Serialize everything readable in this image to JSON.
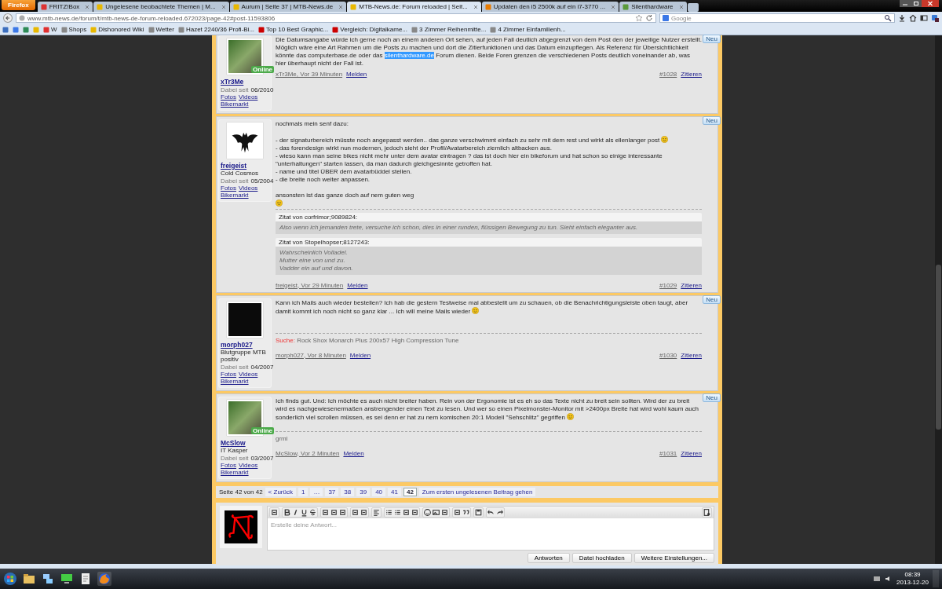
{
  "browser": {
    "menu_button": "Firefox",
    "tabs": [
      {
        "title": "FRITZ!Box",
        "selected": false
      },
      {
        "title": "Ungelesene beobachtete Themen | M...",
        "selected": false
      },
      {
        "title": "Aurum | Seite 37 | MTB-News.de",
        "selected": false
      },
      {
        "title": "MTB-News.de: Forum reloaded | Seit...",
        "selected": true
      },
      {
        "title": "Updaten den i5 2500k auf ein i7-3770 ...",
        "selected": false
      },
      {
        "title": "Silenthardware",
        "selected": false
      }
    ],
    "url": "www.mtb-news.de/forum/t/mtb-news-de-forum-reloaded.672023/page-42#post-11593806",
    "search_placeholder": "Google",
    "bookmarks": [
      {
        "label": "W"
      },
      {
        "label": "Shops"
      },
      {
        "label": "Dishonored Wiki"
      },
      {
        "label": "Wetter"
      },
      {
        "label": "Hazet 2240/36 Profi-Bi..."
      },
      {
        "label": "Top 10 Best Graphic..."
      },
      {
        "label": "Vergleich: Digitalkame..."
      },
      {
        "label": "3 Zimmer Reihenmitte..."
      },
      {
        "label": "4 Zimmer Einfamilienh..."
      }
    ]
  },
  "posts": [
    {
      "user": "xTr3Me",
      "avatar": {
        "kind": "photo"
      },
      "online": true,
      "online_label": "Online",
      "joined_label": "Dabei seit",
      "joined": "06/2010",
      "links": [
        "Fotos",
        "Videos",
        "Bikemarkt"
      ],
      "badge": "Neu",
      "body": [
        {
          "lines": [
            {
              "parts": [
                {
                  "kind": "text",
                  "text": "Die Datumsangabe würde ich gerne noch an einem anderen Ort sehen, auf jeden Fall deutlich abgegrenzt von dem Post den der jeweilige Nutzer erstellt."
                }
              ]
            },
            {
              "parts": [
                {
                  "kind": "text",
                  "text": "Möglich wäre eine Art Rahmen um die Posts zu machen und dort die Zitierfunktionen und das Datum einzupflegen. Als Referenz für Übersichtlichkeit könnte das computerbase.de oder das "
                },
                {
                  "kind": "highlight",
                  "text": "silenthardware.de"
                },
                {
                  "kind": "text",
                  "text": " Forum dienen. Beide Foren grenzen die verschiedenen Posts deutlich voneinander ab, was hier überhaupt nicht der Fall ist."
                }
              ]
            }
          ]
        }
      ],
      "author_time": "xTr3Me, Vor 39 Minuten",
      "report": "Melden",
      "number": "#1028",
      "quote_link": "Zitieren"
    },
    {
      "user": "freigeist",
      "title": "Cold Cosmos",
      "avatar": {
        "kind": "drawing"
      },
      "online": false,
      "joined_label": "Dabei seit",
      "joined": "05/2004",
      "links": [
        "Fotos",
        "Videos",
        "Bikemarkt"
      ],
      "badge": "Neu",
      "body": [
        {
          "lines": [
            {
              "parts": [
                {
                  "kind": "text",
                  "text": "nochmals mein senf dazu:"
                }
              ]
            }
          ]
        },
        {
          "lines": [
            {
              "parts": [
                {
                  "kind": "text",
                  "text": "- der signaturbereich müsste noch angepasst werden.. das ganze verschwimmt einfach zu sehr mit dem rest und wirkt als ellenlanger post"
                },
                {
                  "kind": "smiley"
                }
              ]
            },
            {
              "parts": [
                {
                  "kind": "text",
                  "text": "- das forendesign wirkt nun modernen, jedoch sieht der Profil/Avatarbereich ziemlich altbacken aus."
                }
              ]
            },
            {
              "parts": [
                {
                  "kind": "text",
                  "text": "- wieso kann man seine bikes nicht mehr unter dem avatar eintragen ? das ist doch hier ein bikeforum und hat schon so einige interessante \"unterhaltungen\" starten lassen, da man dadurch gleichgesinnte getroffen hat."
                }
              ]
            },
            {
              "parts": [
                {
                  "kind": "text",
                  "text": "- name und titel ÜBER dem avatarbüddel stellen."
                }
              ]
            },
            {
              "parts": [
                {
                  "kind": "text",
                  "text": "- die breite noch weiter anpassen."
                }
              ]
            }
          ]
        },
        {
          "lines": [
            {
              "parts": [
                {
                  "kind": "text",
                  "text": "ansonsten ist das ganze doch auf nem guten weg"
                }
              ]
            },
            {
              "parts": [
                {
                  "kind": "smiley"
                }
              ]
            }
          ]
        }
      ],
      "quotes": [
        {
          "header": "Zitat von corfrimor;9089824:",
          "lines": [
            "Also wenn ich jemanden trete, versuche ich schon, dies in einer runden, flüssigen Bewegung zu tun. Sieht einfach eleganter aus."
          ]
        },
        {
          "header": "Zitat von Stopelhopser;8127243:",
          "lines": [
            "Wahrscheinlich Volladel.",
            "Mutter eine von und zu.",
            "Vadder ein auf und davon."
          ]
        }
      ],
      "author_time": "freigeist, Vor 29 Minuten",
      "report": "Melden",
      "number": "#1029",
      "quote_link": "Zitieren"
    },
    {
      "user": "morph027",
      "title": "Blutgruppe MTB positiv",
      "avatar": {
        "kind": "dark"
      },
      "online": false,
      "joined_label": "Dabei seit",
      "joined": "04/2007",
      "links": [
        "Fotos",
        "Videos",
        "Bikemarkt"
      ],
      "badge": "Neu",
      "body": [
        {
          "lines": [
            {
              "parts": [
                {
                  "kind": "text",
                  "text": "Kann ich Mails auch wieder bestellen? Ich hab die gestern Testweise mal abbestellt um zu schauen, ob die Benachrichtigungsleiste oben taugt, aber damit kommt ich noch nicht so ganz klar ... Ich will meine Mails wieder"
                },
                {
                  "kind": "smiley"
                }
              ]
            }
          ]
        }
      ],
      "signature": {
        "label": "Suche:",
        "text": "Rock Shox Monarch Plus 200x57 High Compression Tune"
      },
      "author_time": "morph027, Vor 8 Minuten",
      "report": "Melden",
      "number": "#1030",
      "quote_link": "Zitieren"
    },
    {
      "user": "McSlow",
      "title": "IT Kasper",
      "avatar": {
        "kind": "photo"
      },
      "online": true,
      "online_label": "Online",
      "joined_label": "Dabei seit",
      "joined": "03/2007",
      "links": [
        "Fotos",
        "Videos",
        "Bikemarkt"
      ],
      "badge": "Neu",
      "body": [
        {
          "lines": [
            {
              "parts": [
                {
                  "kind": "text",
                  "text": "Ich finds gut. Und: Ich möchte es auch nicht breiter haben. Rein von der Ergonomie ist es eh so das Texte nicht zu breit sein sollten. Wird der zu breit wird es nachgewiesenermaßen anstrengender einen Text zu lesen. Und wer so einen Pixelmonster-Monitor mit >2400px Breite hat wird wohl kaum auch sonderlich viel scrollen müssen, es sei denn er hat zu nem komischen 20:1 Modell \"Sehschlitz\" gegriffen"
                },
                {
                  "kind": "smiley"
                }
              ]
            }
          ]
        }
      ],
      "signature": {
        "text": "grml"
      },
      "author_time": "McSlow, Vor 2 Minuten",
      "report": "Melden",
      "number": "#1031",
      "quote_link": "Zitieren"
    }
  ],
  "pagination": {
    "label": "Seite 42 von 42",
    "prev": "< Zurück",
    "pages": [
      {
        "label": "1",
        "selected": false
      },
      {
        "label": "…",
        "selected": false
      },
      {
        "label": "37",
        "selected": false
      },
      {
        "label": "38",
        "selected": false
      },
      {
        "label": "39",
        "selected": false
      },
      {
        "label": "40",
        "selected": false
      },
      {
        "label": "41",
        "selected": false
      },
      {
        "label": "42",
        "selected": true
      }
    ],
    "unread_link": "Zum ersten ungelesenen Beitrag gehen"
  },
  "editor": {
    "placeholder": "Erstelle deine Antwort...",
    "buttons": [
      "Antworten",
      "Datei hochladen",
      "Weitere Einstellungen..."
    ]
  },
  "taskbar": {
    "time": "08:39",
    "date": "2013-12-20"
  }
}
